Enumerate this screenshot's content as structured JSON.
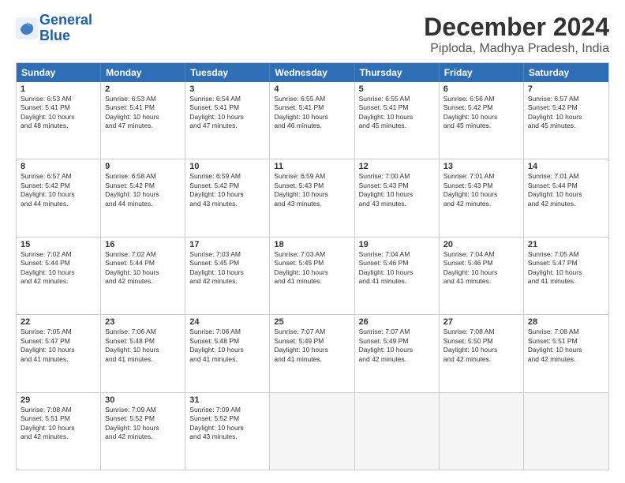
{
  "header": {
    "logo_line1": "General",
    "logo_line2": "Blue",
    "month_title": "December 2024",
    "subtitle": "Piploda, Madhya Pradesh, India"
  },
  "weekdays": [
    "Sunday",
    "Monday",
    "Tuesday",
    "Wednesday",
    "Thursday",
    "Friday",
    "Saturday"
  ],
  "rows": [
    [
      {
        "day": "1",
        "info": "Sunrise: 6:53 AM\nSunset: 5:41 PM\nDaylight: 10 hours\nand 48 minutes."
      },
      {
        "day": "2",
        "info": "Sunrise: 6:53 AM\nSunset: 5:41 PM\nDaylight: 10 hours\nand 47 minutes."
      },
      {
        "day": "3",
        "info": "Sunrise: 6:54 AM\nSunset: 5:41 PM\nDaylight: 10 hours\nand 47 minutes."
      },
      {
        "day": "4",
        "info": "Sunrise: 6:55 AM\nSunset: 5:41 PM\nDaylight: 10 hours\nand 46 minutes."
      },
      {
        "day": "5",
        "info": "Sunrise: 6:55 AM\nSunset: 5:41 PM\nDaylight: 10 hours\nand 45 minutes."
      },
      {
        "day": "6",
        "info": "Sunrise: 6:56 AM\nSunset: 5:42 PM\nDaylight: 10 hours\nand 45 minutes."
      },
      {
        "day": "7",
        "info": "Sunrise: 6:57 AM\nSunset: 5:42 PM\nDaylight: 10 hours\nand 45 minutes."
      }
    ],
    [
      {
        "day": "8",
        "info": "Sunrise: 6:57 AM\nSunset: 5:42 PM\nDaylight: 10 hours\nand 44 minutes."
      },
      {
        "day": "9",
        "info": "Sunrise: 6:58 AM\nSunset: 5:42 PM\nDaylight: 10 hours\nand 44 minutes."
      },
      {
        "day": "10",
        "info": "Sunrise: 6:59 AM\nSunset: 5:42 PM\nDaylight: 10 hours\nand 43 minutes."
      },
      {
        "day": "11",
        "info": "Sunrise: 6:59 AM\nSunset: 5:43 PM\nDaylight: 10 hours\nand 43 minutes."
      },
      {
        "day": "12",
        "info": "Sunrise: 7:00 AM\nSunset: 5:43 PM\nDaylight: 10 hours\nand 43 minutes."
      },
      {
        "day": "13",
        "info": "Sunrise: 7:01 AM\nSunset: 5:43 PM\nDaylight: 10 hours\nand 42 minutes."
      },
      {
        "day": "14",
        "info": "Sunrise: 7:01 AM\nSunset: 5:44 PM\nDaylight: 10 hours\nand 42 minutes."
      }
    ],
    [
      {
        "day": "15",
        "info": "Sunrise: 7:02 AM\nSunset: 5:44 PM\nDaylight: 10 hours\nand 42 minutes."
      },
      {
        "day": "16",
        "info": "Sunrise: 7:02 AM\nSunset: 5:44 PM\nDaylight: 10 hours\nand 42 minutes."
      },
      {
        "day": "17",
        "info": "Sunrise: 7:03 AM\nSunset: 5:45 PM\nDaylight: 10 hours\nand 42 minutes."
      },
      {
        "day": "18",
        "info": "Sunrise: 7:03 AM\nSunset: 5:45 PM\nDaylight: 10 hours\nand 41 minutes."
      },
      {
        "day": "19",
        "info": "Sunrise: 7:04 AM\nSunset: 5:46 PM\nDaylight: 10 hours\nand 41 minutes."
      },
      {
        "day": "20",
        "info": "Sunrise: 7:04 AM\nSunset: 5:46 PM\nDaylight: 10 hours\nand 41 minutes."
      },
      {
        "day": "21",
        "info": "Sunrise: 7:05 AM\nSunset: 5:47 PM\nDaylight: 10 hours\nand 41 minutes."
      }
    ],
    [
      {
        "day": "22",
        "info": "Sunrise: 7:05 AM\nSunset: 5:47 PM\nDaylight: 10 hours\nand 41 minutes."
      },
      {
        "day": "23",
        "info": "Sunrise: 7:06 AM\nSunset: 5:48 PM\nDaylight: 10 hours\nand 41 minutes."
      },
      {
        "day": "24",
        "info": "Sunrise: 7:06 AM\nSunset: 5:48 PM\nDaylight: 10 hours\nand 41 minutes."
      },
      {
        "day": "25",
        "info": "Sunrise: 7:07 AM\nSunset: 5:49 PM\nDaylight: 10 hours\nand 41 minutes."
      },
      {
        "day": "26",
        "info": "Sunrise: 7:07 AM\nSunset: 5:49 PM\nDaylight: 10 hours\nand 42 minutes."
      },
      {
        "day": "27",
        "info": "Sunrise: 7:08 AM\nSunset: 5:50 PM\nDaylight: 10 hours\nand 42 minutes."
      },
      {
        "day": "28",
        "info": "Sunrise: 7:08 AM\nSunset: 5:51 PM\nDaylight: 10 hours\nand 42 minutes."
      }
    ],
    [
      {
        "day": "29",
        "info": "Sunrise: 7:08 AM\nSunset: 5:51 PM\nDaylight: 10 hours\nand 42 minutes."
      },
      {
        "day": "30",
        "info": "Sunrise: 7:09 AM\nSunset: 5:52 PM\nDaylight: 10 hours\nand 42 minutes."
      },
      {
        "day": "31",
        "info": "Sunrise: 7:09 AM\nSunset: 5:52 PM\nDaylight: 10 hours\nand 43 minutes."
      },
      {
        "day": "",
        "info": ""
      },
      {
        "day": "",
        "info": ""
      },
      {
        "day": "",
        "info": ""
      },
      {
        "day": "",
        "info": ""
      }
    ]
  ]
}
